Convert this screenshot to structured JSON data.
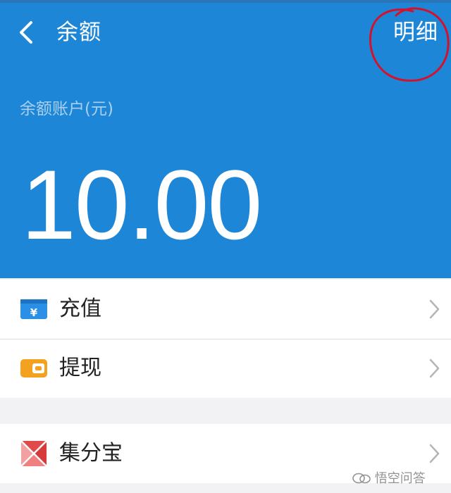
{
  "nav": {
    "title": "余额",
    "detail_label": "明细"
  },
  "account": {
    "label": "余额账户(元)",
    "balance": "10.00"
  },
  "menu_group_1": [
    {
      "label": "充值",
      "icon": "recharge-yen-icon"
    },
    {
      "label": "提现",
      "icon": "wallet-withdraw-icon"
    }
  ],
  "menu_group_2": [
    {
      "label": "集分宝",
      "icon": "jifenbao-icon"
    }
  ],
  "watermark": {
    "text": "悟空问答"
  },
  "colors": {
    "header_bg": "#1e86d6",
    "annotation_circle": "#d3122c",
    "recharge_icon": "#2a8fe6",
    "withdraw_icon": "#f2a21f",
    "jifenbao_icon": "#e04a4a"
  }
}
